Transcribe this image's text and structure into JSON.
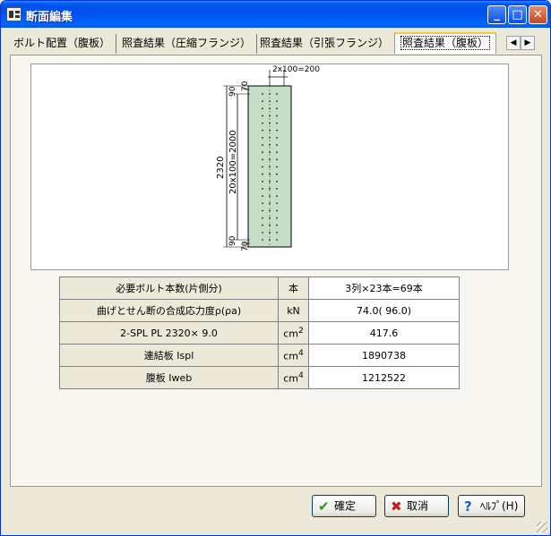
{
  "window": {
    "title": "断面編集",
    "controls": {
      "minimize": "_",
      "maximize": "□",
      "close": "✕"
    }
  },
  "tabs": [
    {
      "label": "ボルト配置（腹板）",
      "active": false
    },
    {
      "label": "照査結果（圧縮フランジ）",
      "active": false
    },
    {
      "label": "照査結果（引張フランジ）",
      "active": false
    },
    {
      "label": "照査結果（腹板）",
      "active": true
    }
  ],
  "tab_scroll": {
    "left_icon": "arrow-left-icon",
    "right_icon": "arrow-right-icon"
  },
  "drawing": {
    "top_dim": "2x100=200",
    "total_dim": "2320",
    "pitch_dim": "20x100=2000",
    "top_edge_a": "90",
    "top_edge_b": "70",
    "bottom_edge_a": "90",
    "bottom_edge_b": "70",
    "plate_color": "#c6dec6",
    "bolt_rows": 21,
    "bolt_cols": 3
  },
  "table": {
    "rows": [
      {
        "label": "必要ボルト本数(片側分)",
        "unit": "本",
        "value": "3列×23本=69本"
      },
      {
        "label": "曲げとせん断の合成応力度ρ(ρa)",
        "unit": "kN",
        "value": "74.0( 96.0)"
      },
      {
        "label": "2-SPL PL 2320× 9.0",
        "unit": "cm",
        "unit_sup": "2",
        "value": "417.6"
      },
      {
        "label": "連結板 Ispl",
        "unit": "cm",
        "unit_sup": "4",
        "value": "1890738"
      },
      {
        "label": "腹板 Iweb",
        "unit": "cm",
        "unit_sup": "4",
        "value": "1212522"
      }
    ]
  },
  "buttons": {
    "ok": {
      "label": "確定",
      "icon": "check-icon",
      "color": "#1f9a1f"
    },
    "cancel": {
      "label": "取消",
      "icon": "x-icon",
      "color": "#c41b1b"
    },
    "help": {
      "label": "ﾍﾙﾌﾟ(H)",
      "icon": "question-icon",
      "color": "#1d5fc9"
    }
  }
}
